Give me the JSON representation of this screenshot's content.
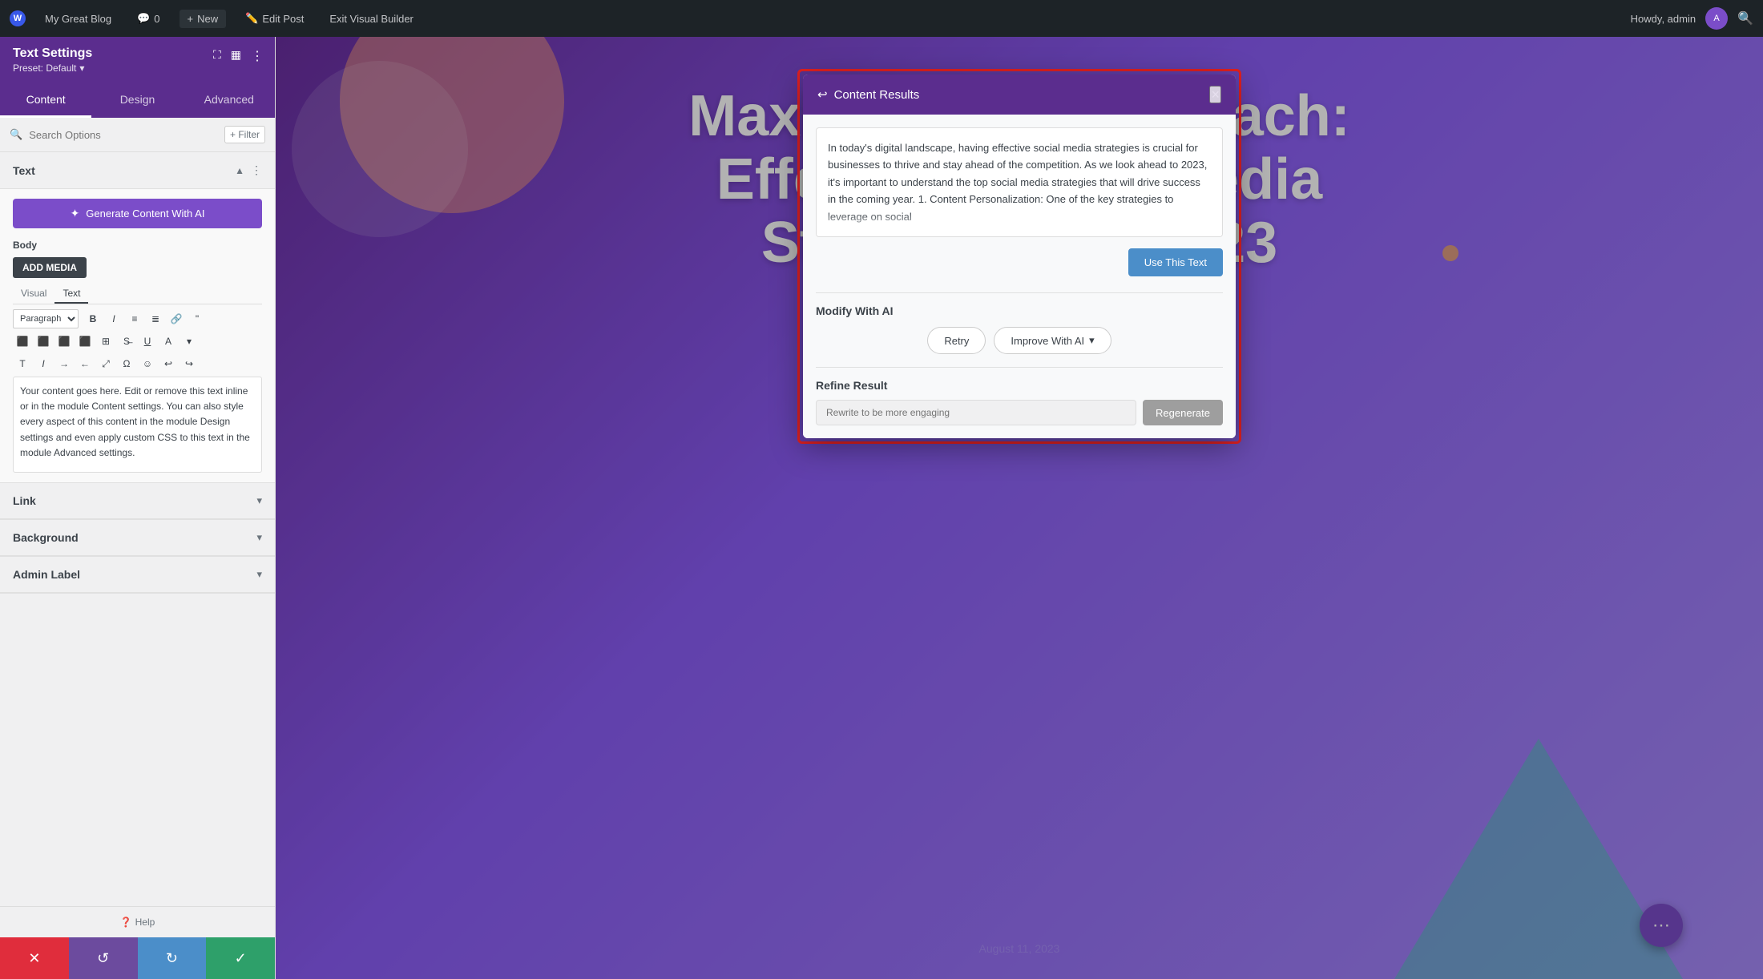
{
  "adminBar": {
    "siteName": "My Great Blog",
    "commentCount": "0",
    "newLabel": "New",
    "editPost": "Edit Post",
    "exitBuilder": "Exit Visual Builder",
    "howdy": "Howdy, admin"
  },
  "sidebar": {
    "title": "Text Settings",
    "preset": "Preset: Default",
    "tabs": [
      {
        "label": "Content",
        "active": true
      },
      {
        "label": "Design",
        "active": false
      },
      {
        "label": "Advanced",
        "active": false
      }
    ],
    "search": {
      "placeholder": "Search Options",
      "filterLabel": "+ Filter"
    },
    "sections": {
      "text": {
        "label": "Text",
        "generateBtn": "Generate Content With AI",
        "bodyLabel": "Body",
        "addMediaBtn": "ADD MEDIA",
        "editorTabs": [
          "Visual",
          "Text"
        ],
        "editorContent": "Your content goes here. Edit or remove this text inline or in the module Content settings. You can also style every aspect of this content in the module Design settings and even apply custom CSS to this text in the module Advanced settings."
      },
      "link": {
        "label": "Link"
      },
      "background": {
        "label": "Background"
      },
      "adminLabel": {
        "label": "Admin Label"
      }
    },
    "helpBtn": "Help",
    "actions": {
      "cancel": "✕",
      "undo": "↺",
      "redo": "↻",
      "save": "✓"
    }
  },
  "modal": {
    "title": "Content Results",
    "closeIcon": "×",
    "backIcon": "←",
    "generatedText": "In today's digital landscape, having effective social media strategies is crucial for businesses to thrive and stay ahead of the competition. As we look ahead to 2023, it's important to understand the top social media strategies that will drive success in the coming year.\n\n1. Content Personalization: One of the key strategies to leverage on social",
    "useTextBtn": "Use This Text",
    "modifySection": {
      "label": "Modify With AI",
      "retryBtn": "Retry",
      "improveBtn": "Improve With AI",
      "chevron": "▾"
    },
    "refineSection": {
      "label": "Refine Result",
      "placeholder": "Rewrite to be more engaging",
      "regenerateBtn": "Regenerate"
    }
  },
  "canvas": {
    "heroTitle": "Maximizing Your Reach: Effective Social Media Strategies for 2023",
    "date": "August 11, 2023"
  },
  "colors": {
    "purple": "#5b2d8e",
    "lightPurple": "#7b4dc9",
    "blue": "#4b8ec9",
    "red": "#e02d3c",
    "green": "#2ea06a",
    "undoBg": "#6c4b9e"
  }
}
